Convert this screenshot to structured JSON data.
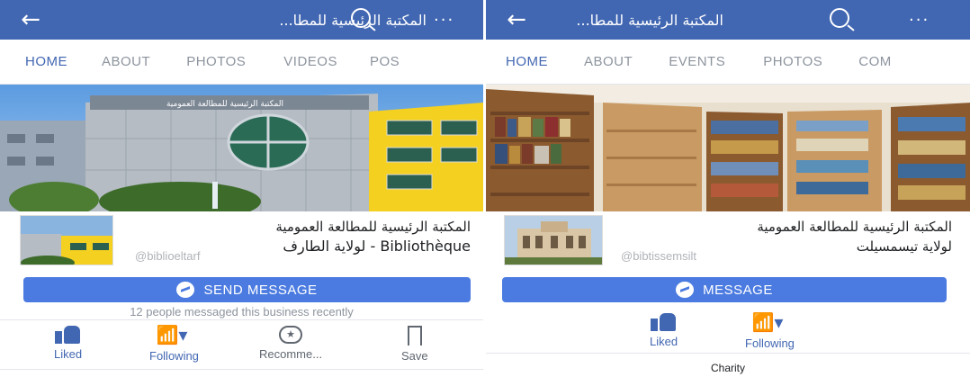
{
  "colors": {
    "bar": "#4267b2",
    "button": "#4b7be0",
    "tab_active": "#4267b2",
    "tab_inactive": "#8d949e"
  },
  "left": {
    "title": "المكتبة الرئيسية للمطا...",
    "icons": {
      "back": "back-arrow-icon",
      "search": "search-icon",
      "more": "more-dots-icon"
    },
    "tabs": [
      "HOME",
      "ABOUT",
      "PHOTOS",
      "VIDEOS",
      "POS"
    ],
    "cover_sign": "المكتبة الرئيسية للمطالعة العمومية",
    "page_name_line1": "المكتبة الرئيسية للمطالعة العمومية",
    "page_name_line2": "Bibliothèque - لولاية الطارف",
    "handle": "@biblioeltarf",
    "button": "SEND MESSAGE",
    "note": "12 people messaged this business recently",
    "actions": [
      "Liked",
      "Following",
      "Recomme...",
      "Save"
    ]
  },
  "right": {
    "title": "المكتبة الرئيسية للمطا...",
    "icons": {
      "back": "back-arrow-icon",
      "search": "search-icon",
      "more": "more-dots-icon"
    },
    "tabs": [
      "HOME",
      "ABOUT",
      "EVENTS",
      "PHOTOS",
      "COM"
    ],
    "page_name_line1": "المكتبة الرئيسية للمطالعة العمومية",
    "page_name_line2": "لولاية تيسمسيلت",
    "handle": "@bibtissemsilt",
    "button": "MESSAGE",
    "actions": [
      "Liked",
      "Following"
    ],
    "category": "Charity"
  }
}
